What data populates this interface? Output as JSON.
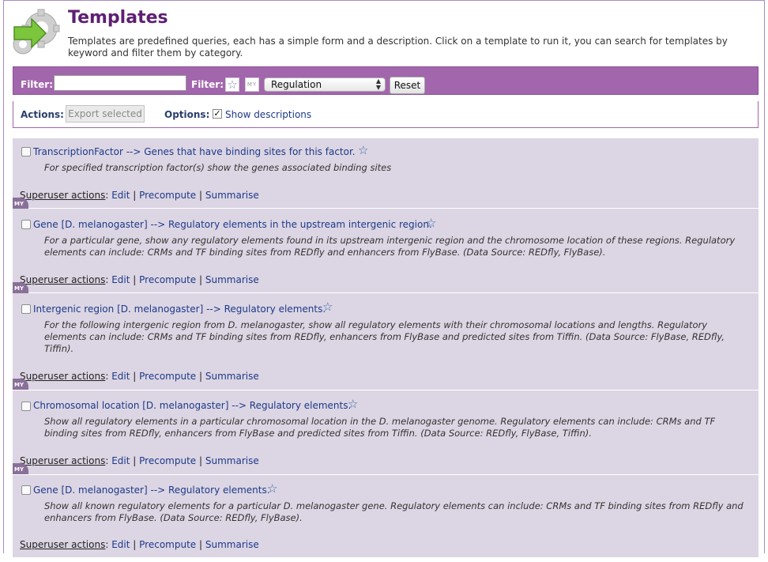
{
  "page": {
    "title": "Templates",
    "intro": "Templates are predefined queries, each has a simple form and a description. Click on a template to run it, you can search for templates by keyword and filter them by category."
  },
  "filters": {
    "filter_label": "Filter:",
    "filter2_label": "Filter:",
    "search_value": "",
    "search_placeholder": "",
    "my_label": "MY",
    "category_selected": "Regulation",
    "reset_label": "Reset"
  },
  "actions": {
    "actions_label": "Actions:",
    "export_label": "Export selected",
    "options_label": "Options:",
    "show_descriptions_label": "Show descriptions",
    "show_descriptions_checked": true
  },
  "superuser": {
    "label": "Superuser actions",
    "edit": "Edit",
    "precompute": "Precompute",
    "summarise": "Summarise",
    "separator": "|",
    "my_tag": "MY"
  },
  "templates": [
    {
      "name": "TranscriptionFactor --> Genes that have binding sites for this factor.",
      "description": "For specified transcription factor(s) show the genes associated binding sites"
    },
    {
      "name": "Gene [D. melanogaster] --> Regulatory elements in the upstream intergenic region.",
      "description": "For a particular gene, show any regulatory elements found in its upstream intergenic region and the chromosome location of these regions. Regulatory elements can include: CRMs and TF binding sites from REDfly and enhancers from FlyBase. (Data Source: REDfly, FlyBase)."
    },
    {
      "name": "Intergenic region [D. melanogaster] --> Regulatory elements.",
      "description": "For the following intergenic region from D. melanogaster, show all regulatory elements with their chromosomal locations and lengths. Regulatory elements can include: CRMs and TF binding sites from REDfly, enhancers from FlyBase and predicted sites from Tiffin. (Data Source: FlyBase, REDfly, Tiffin)."
    },
    {
      "name": "Chromosomal location [D. melanogaster] --> Regulatory elements.",
      "description": "Show all regulatory elements in a particular chromosomal location in the D. melanogaster genome. Regulatory elements can include: CRMs and TF binding sites from REDfly, enhancers from FlyBase and predicted sites from Tiffin. (Data Source: REDfly, FlyBase, Tiffin)."
    },
    {
      "name": "Gene [D. melanogaster] --> Regulatory elements.",
      "description": "Show all known regulatory elements for a particular D. melanogaster gene. Regulatory elements can include: CRMs and TF binding sites from REDfly and enhancers from FlyBase. (Data Source: REDfly, FlyBase)."
    }
  ],
  "colors": {
    "title": "#5e1e73",
    "filter_bar": "#a266ad",
    "list_background": "#dcd5e3",
    "link": "#1c3a8a"
  },
  "icons": {
    "logo": "templates-gear-arrow-icon",
    "favourite": "star-outline-icon"
  }
}
